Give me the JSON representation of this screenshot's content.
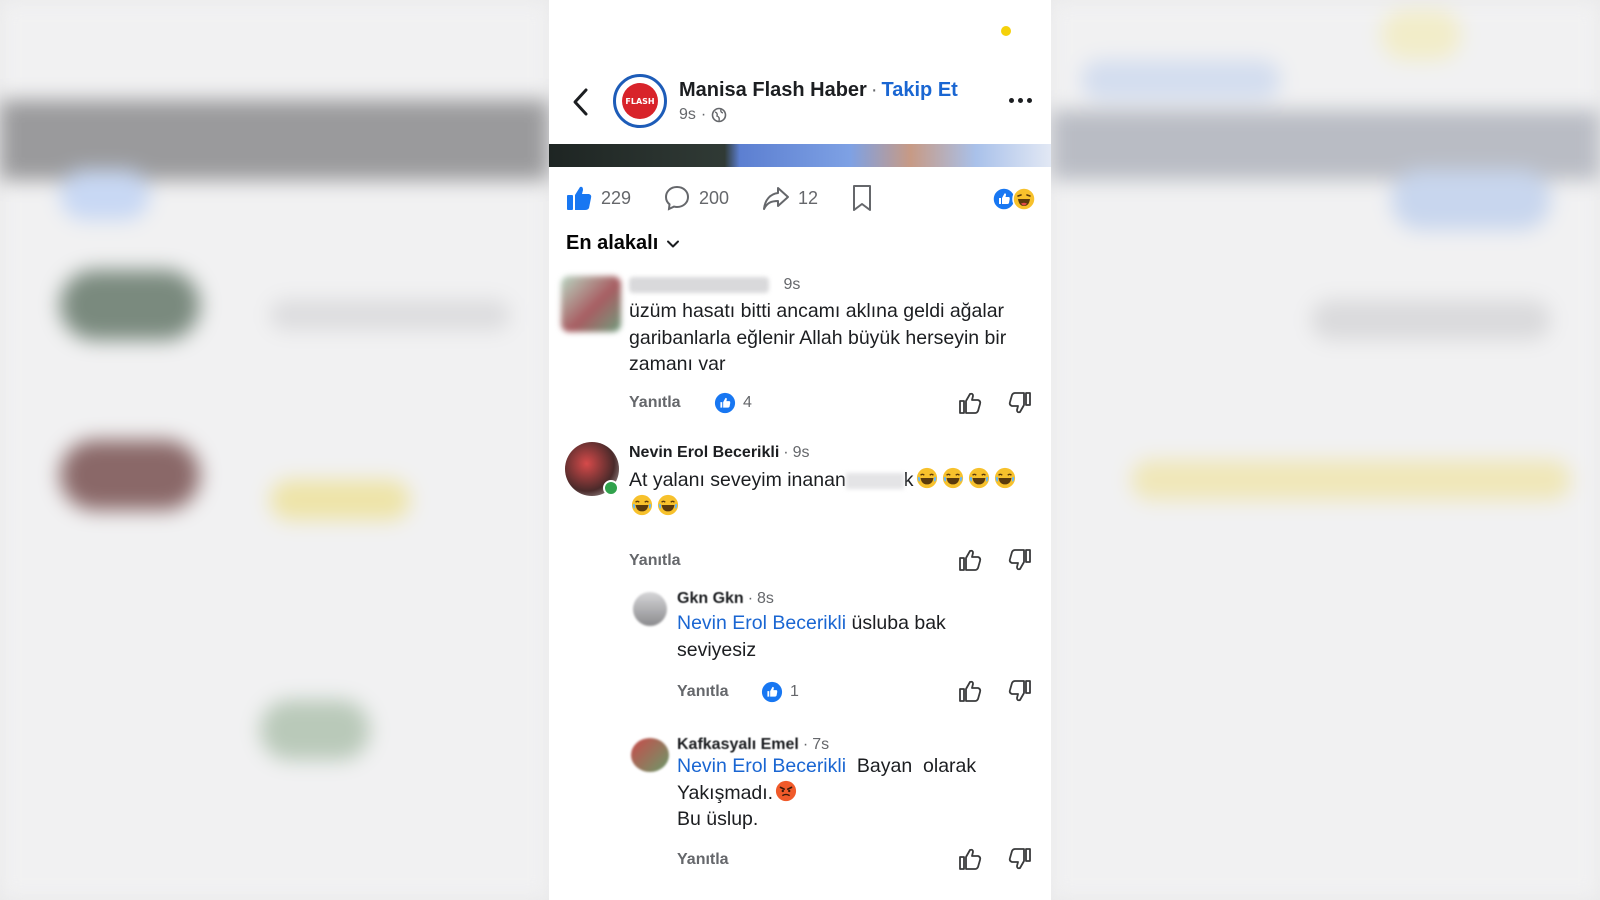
{
  "page": {
    "name": "Manisa Flash Haber",
    "follow_label": "Takip Et",
    "time": "9s",
    "avatar_text": "FLASH"
  },
  "post": {
    "like_count": "229",
    "comment_count": "200",
    "share_count": "12"
  },
  "sort": {
    "label": "En alakalı"
  },
  "comments": [
    {
      "time": "9s",
      "text": "üzüm hasatı bitti ancamı aklına geldi ağalar garibanlarla eğlenir Allah büyük herseyin bir zamanı var",
      "reply_label": "Yanıtla",
      "likes": "4"
    },
    {
      "name": "Nevin Erol Becerikli",
      "time": "9s",
      "text_start": "At yalanı seveyim inanan",
      "text_end": "k",
      "reply_label": "Yanıtla"
    },
    {
      "name": "Gkn Gkn",
      "time": "8s",
      "mention": "Nevin Erol Becerikli",
      "text": "üsluba bak seviyesiz",
      "reply_label": "Yanıtla",
      "likes": "1"
    },
    {
      "name": "Kafkasyalı Emel",
      "time": "7s",
      "mention": "Nevin Erol Becerikli",
      "text_line1": "Bayan  olarak",
      "text_line2": "Yakışmadı.",
      "text_line3": "Bu üslup.",
      "reply_label": "Yanıtla"
    }
  ],
  "colors": {
    "accent_blue": "#1a66d2",
    "brand_red": "#d8232a",
    "status_yellow": "#f5d10a"
  }
}
